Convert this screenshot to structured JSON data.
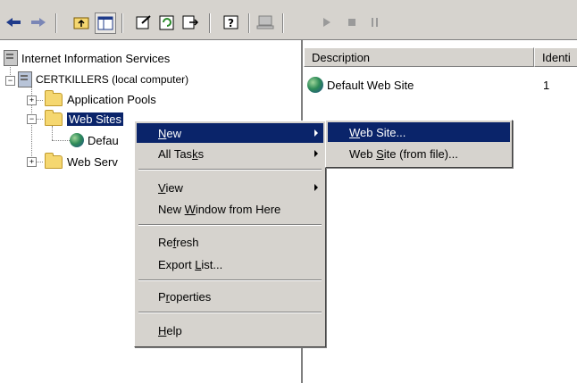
{
  "toolbar": {
    "buttons": [
      "back-arrow-icon",
      "forward-arrow-icon",
      "up-folder-icon",
      "show-hide-tree-icon",
      "properties-icon",
      "refresh-icon",
      "export-list-icon",
      "help-icon",
      "server-icon",
      "play-icon",
      "stop-icon",
      "pause-icon"
    ]
  },
  "tree": {
    "root": "Internet Information Services",
    "computer": "CERTKILLERS (local computer)",
    "app_pools": "Application Pools",
    "web_sites": "Web Sites",
    "default_site_truncated": "Defau",
    "web_service_truncated": "Web Serv"
  },
  "list": {
    "columns": [
      "Description",
      "Identi"
    ],
    "rows": [
      {
        "description": "Default Web Site",
        "identifier": "1"
      }
    ]
  },
  "context_menu": {
    "new": "New",
    "all_tasks": "All Tasks",
    "view": "View",
    "new_window": "New Window from Here",
    "refresh": "Refresh",
    "export_list": "Export List...",
    "properties": "Properties",
    "help": "Help"
  },
  "submenu": {
    "web_site": "Web Site...",
    "web_site_file": "Web Site (from file)..."
  },
  "colors": {
    "highlight": "#0a246a",
    "face": "#d6d3ce"
  }
}
